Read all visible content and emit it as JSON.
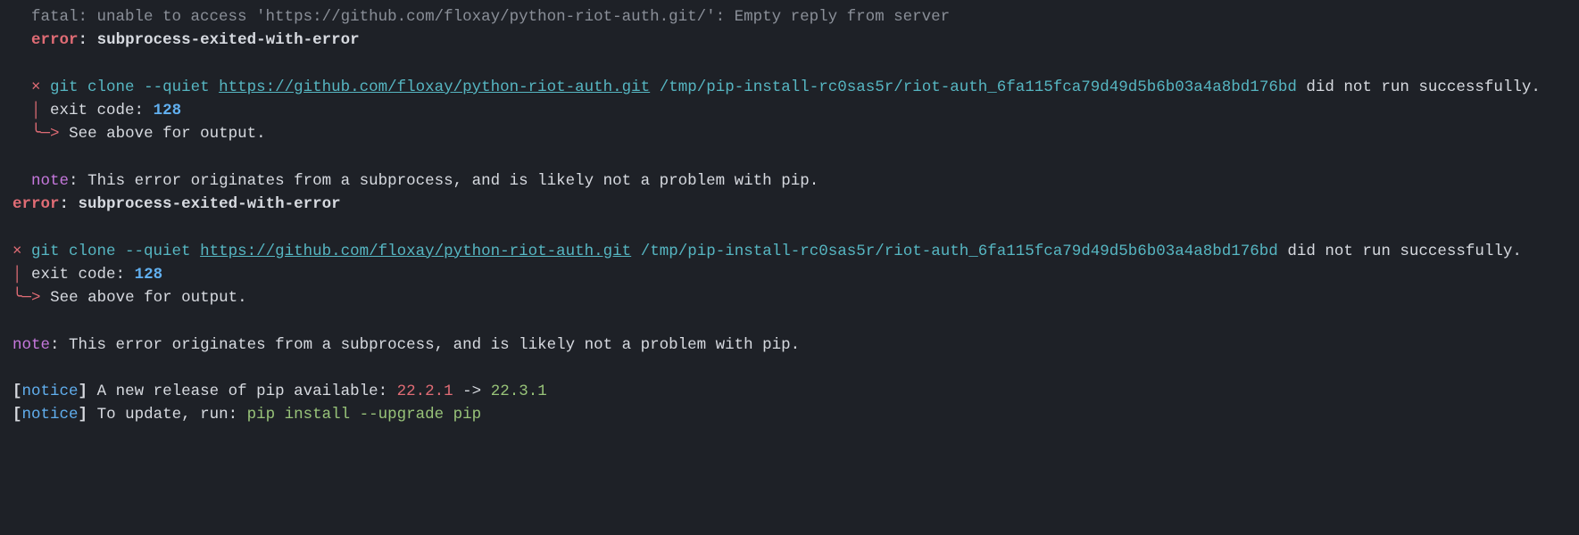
{
  "line1": "  fatal: unable to access 'https://github.com/floxay/python-riot-auth.git/': Empty reply from server",
  "error_label": "error",
  "colon": ":",
  "sp": " ",
  "subprocess_err": "subprocess-exited-with-error",
  "cross": "×",
  "git_cmd": "git clone --quiet",
  "git_url": "https://github.com/floxay/python-riot-auth.git",
  "git_path": "/tmp/pip-install-rc0sas5r/riot-auth_6fa115fca79d49d5b6b03a4a8bd176bd",
  "not_success": " did not run successfully.",
  "pipe": "│",
  "exit_code_label": "exit code:",
  "exit_code": "128",
  "arrow": "╰─>",
  "see_above": "See above for output.",
  "note_label": "note",
  "note_text": "This error originates from a subprocess, and is likely not a problem with pip.",
  "lb": "[",
  "rb": "]",
  "notice": "notice",
  "notice1a": "A new release of pip available:",
  "old_ver": "22.2.1",
  "arr_sep": "->",
  "new_ver": "22.3.1",
  "notice2a": "To update, run:",
  "upgrade_cmd": "pip install --upgrade pip"
}
